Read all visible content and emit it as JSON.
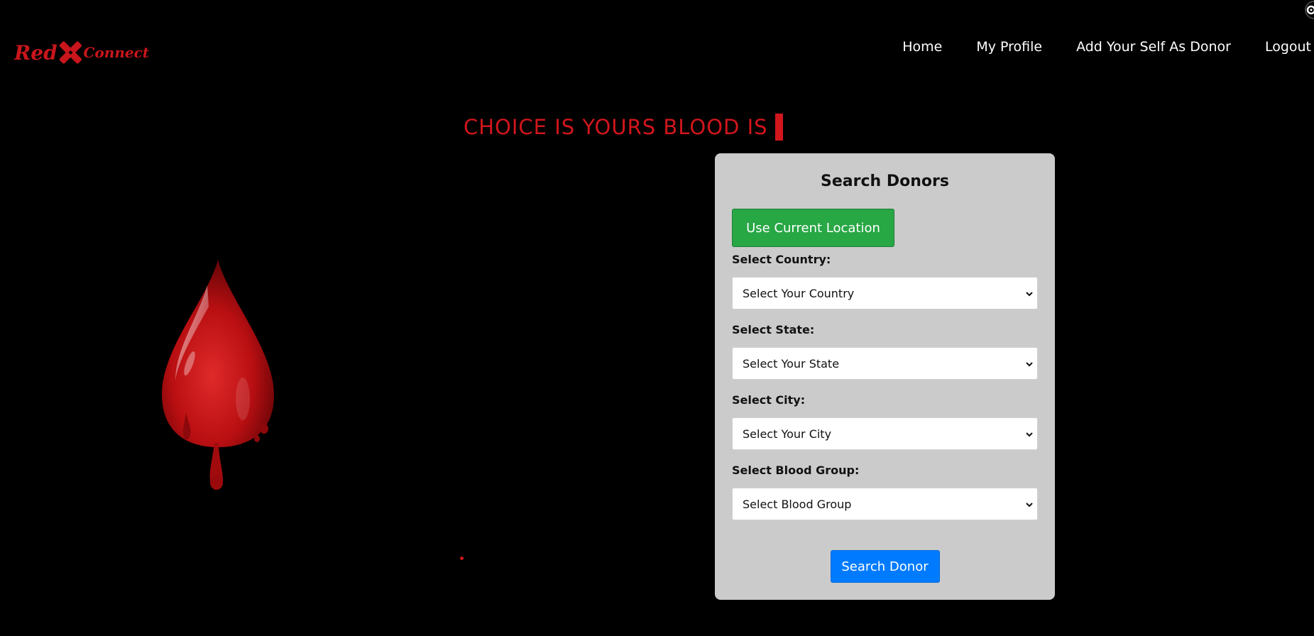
{
  "brand": {
    "name_left": "Red",
    "name_right": "Connect",
    "color": "#c8161c"
  },
  "nav": {
    "items": [
      {
        "label": "Home"
      },
      {
        "label": "My Profile"
      },
      {
        "label": "Add Your Self As Donor"
      },
      {
        "label": "Logout"
      }
    ]
  },
  "hero": {
    "headline": "CHOICE IS YOURS BLOOD IS",
    "accent_color": "#d1161c"
  },
  "search": {
    "title": "Search Donors",
    "location_button": "Use Current Location",
    "fields": [
      {
        "label": "Select Country:",
        "selected": "Select Your Country"
      },
      {
        "label": "Select State:",
        "selected": "Select Your State"
      },
      {
        "label": "Select City:",
        "selected": "Select Your City"
      },
      {
        "label": "Select Blood Group:",
        "selected": "Select Blood Group"
      }
    ],
    "submit_button": "Search Donor",
    "card_color": "#cbcbcb",
    "location_button_color": "#28a745",
    "submit_button_color": "#007bff"
  },
  "icons": {
    "logo_mark": "x-cross-icon",
    "hero_image": "blood-drop-icon",
    "corner": "settings-gear-icon",
    "select_arrow": "chevron-down-icon"
  }
}
